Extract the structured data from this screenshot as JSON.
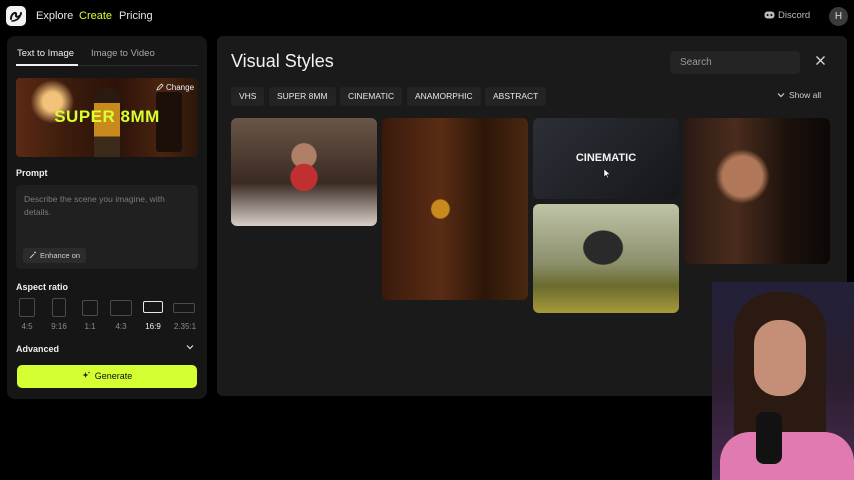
{
  "topbar": {
    "nav": [
      "Explore",
      "Create",
      "Pricing"
    ],
    "discord_label": "Discord",
    "avatar_initial": "H"
  },
  "left_panel": {
    "tabs": [
      "Text to Image",
      "Image to Video"
    ],
    "style_thumb": {
      "title": "SUPER 8MM",
      "change_label": "Change"
    },
    "prompt_label": "Prompt",
    "prompt_placeholder": "Describe the scene you imagine, with details.",
    "enhance_label": "Enhance on",
    "aspect_ratio_label": "Aspect ratio",
    "aspect_ratios": [
      "4:5",
      "9:16",
      "1:1",
      "4:3",
      "16:9",
      "2.35:1"
    ],
    "selected_aspect_ratio": "16:9",
    "advanced_label": "Advanced",
    "generate_label": "Generate"
  },
  "main_panel": {
    "title": "Visual Styles",
    "search_placeholder": "Search",
    "filters": [
      "VHS",
      "SUPER 8MM",
      "CINEMATIC",
      "ANAMORPHIC",
      "ABSTRACT"
    ],
    "show_all_label": "Show all",
    "cards": [
      {
        "label": ""
      },
      {
        "label": ""
      },
      {
        "label": "CINEMATIC"
      },
      {
        "label": ""
      },
      {
        "label": ""
      }
    ]
  },
  "colors": {
    "accent": "#d4ff33",
    "background": "#000000",
    "panel": "#161616"
  }
}
